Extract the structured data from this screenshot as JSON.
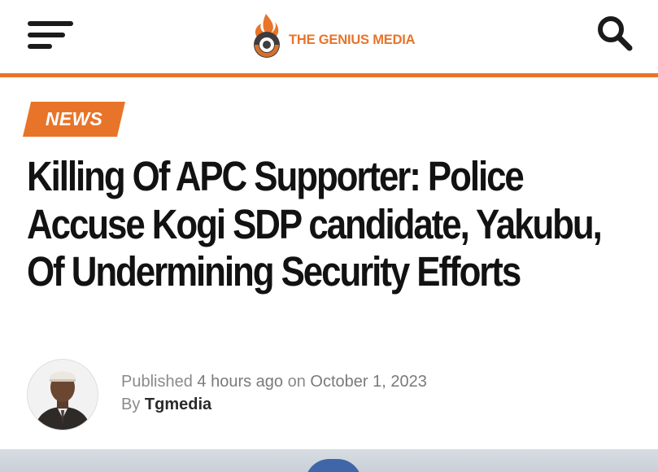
{
  "header": {
    "menu_icon": "hamburger-menu-icon",
    "logo_text": "THE GENIUS MEDIA",
    "search_icon": "search-icon",
    "accent_color": "#e8742a"
  },
  "article": {
    "category": "NEWS",
    "title": "Killing Of APC Supporter: Police Accuse Kogi SDP candidate, Yakubu, Of Undermining Security Efforts",
    "meta": {
      "published_prefix": "Published",
      "relative_time": "4 hours ago",
      "on_word": "on",
      "date": "October 1, 2023",
      "by_word": "By",
      "author": "Tgmedia"
    }
  }
}
